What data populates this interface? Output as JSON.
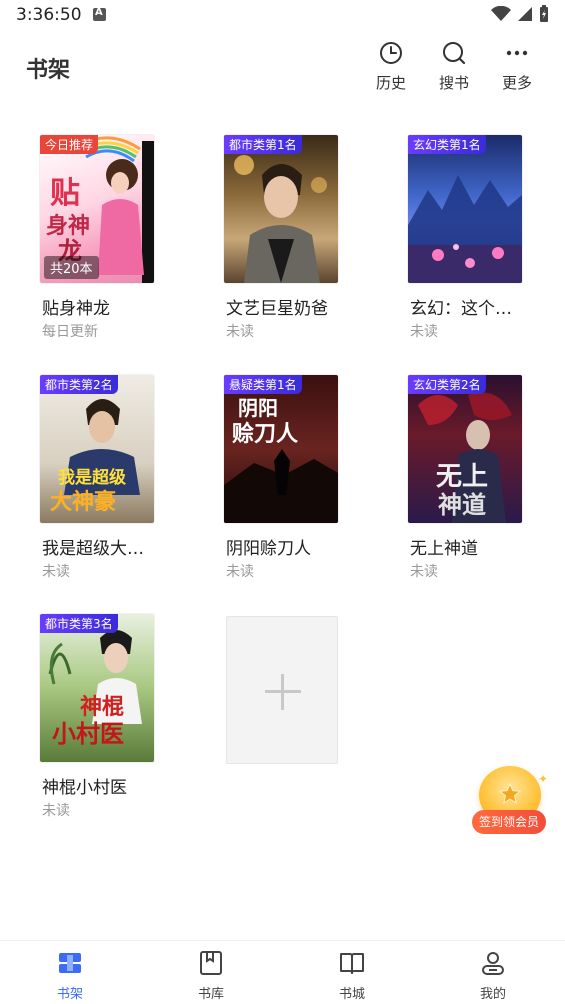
{
  "status": {
    "time": "3:36:50"
  },
  "header": {
    "title": "书架",
    "actions": [
      {
        "label": "历史",
        "icon": "history-icon"
      },
      {
        "label": "搜书",
        "icon": "search-icon"
      },
      {
        "label": "更多",
        "icon": "more-icon"
      }
    ]
  },
  "books": [
    {
      "title": "贴身神龙",
      "status": "每日更新",
      "badge": "今日推荐",
      "count": "共20本"
    },
    {
      "title": "文艺巨星奶爸",
      "status": "未读",
      "badge": "都市类第1名"
    },
    {
      "title": "玄幻：这个…",
      "status": "未读",
      "badge": "玄幻类第1名"
    },
    {
      "title": "我是超级大…",
      "status": "未读",
      "badge": "都市类第2名"
    },
    {
      "title": "阴阳赊刀人",
      "status": "未读",
      "badge": "悬疑类第1名"
    },
    {
      "title": "无上神道",
      "status": "未读",
      "badge": "玄幻类第2名"
    },
    {
      "title": "神棍小村医",
      "status": "未读",
      "badge": "都市类第3名"
    }
  ],
  "float": {
    "label": "签到领会员"
  },
  "nav": [
    {
      "label": "书架",
      "icon": "bookshelf-icon",
      "active": true
    },
    {
      "label": "书库",
      "icon": "library-icon",
      "active": false
    },
    {
      "label": "书城",
      "icon": "bookstore-icon",
      "active": false
    },
    {
      "label": "我的",
      "icon": "profile-icon",
      "active": false
    }
  ],
  "colors": {
    "accent": "#3b6cf6",
    "rank_badge": "#4a32e0",
    "recommend_badge": "#e8463b"
  }
}
